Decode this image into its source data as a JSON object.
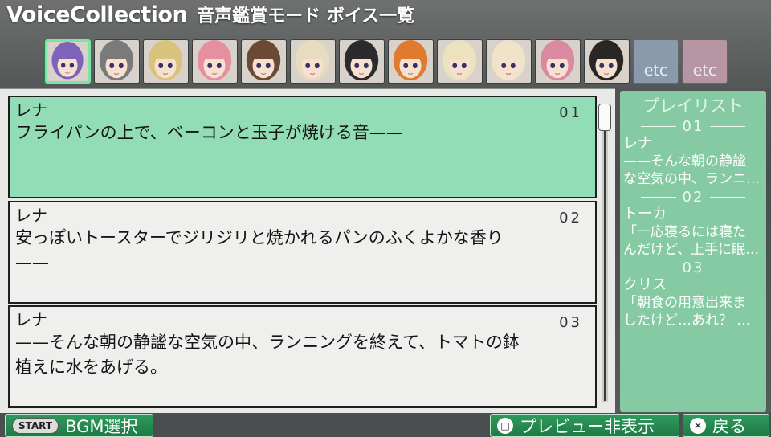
{
  "header": {
    "title": "VoiceCollection",
    "subtitle": "音声鑑賞モード ボイス一覧"
  },
  "characters": [
    {
      "id": "char-1",
      "hair": "#7f63b8",
      "selected": true
    },
    {
      "id": "char-2",
      "hair": "#7a7a7a",
      "selected": false
    },
    {
      "id": "char-3",
      "hair": "#d9c27c",
      "selected": false
    },
    {
      "id": "char-4",
      "hair": "#e58fa0",
      "selected": false
    },
    {
      "id": "char-5",
      "hair": "#6b4a35",
      "selected": false
    },
    {
      "id": "char-6",
      "hair": "#e8dcc0",
      "selected": false
    },
    {
      "id": "char-7",
      "hair": "#2b2b2e",
      "selected": false
    },
    {
      "id": "char-8",
      "hair": "#e07a2c",
      "selected": false
    },
    {
      "id": "char-9",
      "hair": "#ece2bd",
      "selected": false
    },
    {
      "id": "char-10",
      "hair": "#f0e3c8",
      "selected": false
    },
    {
      "id": "char-11",
      "hair": "#d98aa0",
      "selected": false
    },
    {
      "id": "char-12",
      "hair": "#2a2626",
      "selected": false
    }
  ],
  "etc_tiles": [
    {
      "label": "etc",
      "color": "blue"
    },
    {
      "label": "etc",
      "color": "pink"
    }
  ],
  "voices": [
    {
      "name": "レナ",
      "num": "01",
      "text_lines": [
        "フライパンの上で、ベーコンと玉子が焼ける音——"
      ]
    },
    {
      "name": "レナ",
      "num": "02",
      "text_lines": [
        "安っぽいトースターでジリジリと焼かれるパンのふくよかな香り",
        "——"
      ]
    },
    {
      "name": "レナ",
      "num": "03",
      "text_lines": [
        "——そんな朝の静謐な空気の中、ランニングを終えて、トマトの鉢",
        "植えに水をあげる。"
      ]
    }
  ],
  "playlist": {
    "title": "プレイリスト",
    "items": [
      {
        "num": "01",
        "name": "レナ",
        "lines": [
          "——そんな朝の静謐",
          "な空気の中、ランニ…"
        ]
      },
      {
        "num": "02",
        "name": "トーカ",
        "lines": [
          "「一応寝るには寝た",
          "んだけど、上手に眠…"
        ]
      },
      {
        "num": "03",
        "name": "クリス",
        "lines": [
          "「朝食の用意出来ま",
          "したけど…あれ？ …"
        ]
      }
    ]
  },
  "bottom": {
    "start_label": "START",
    "bgm_label": "BGM選択",
    "preview_label": "プレビュー非表示",
    "back_label": "戻る"
  },
  "colors": {
    "selected_entry": "#92ddb6",
    "playlist_bg": "#85caa3",
    "button_green": "#2f9a5d"
  }
}
